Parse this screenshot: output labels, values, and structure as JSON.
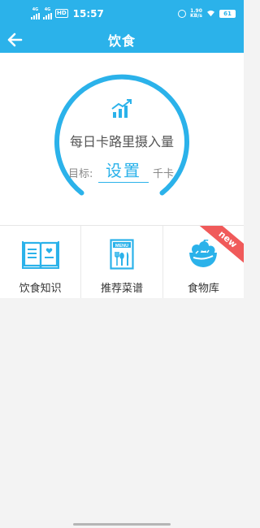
{
  "status_bar": {
    "time": "15:57",
    "network_1": "4G",
    "network_2": "4G",
    "hd": "HD",
    "speed_value": "1.90",
    "speed_unit": "KB/s",
    "battery": "61"
  },
  "nav": {
    "title": "饮食",
    "back_icon": "arrow-left-icon"
  },
  "calorie_card": {
    "title": "每日卡路里摄入量",
    "goal_label": "目标:",
    "goal_action": "设置",
    "unit": "千卡",
    "icon": "bar-chart-icon",
    "accent_color": "#2bb2ea"
  },
  "features": [
    {
      "label": "饮食知识",
      "icon": "book-icon"
    },
    {
      "label": "推荐菜谱",
      "icon": "menu-icon",
      "icon_text": "MENU"
    },
    {
      "label": "食物库",
      "icon": "food-bowl-icon",
      "badge": "new"
    }
  ]
}
